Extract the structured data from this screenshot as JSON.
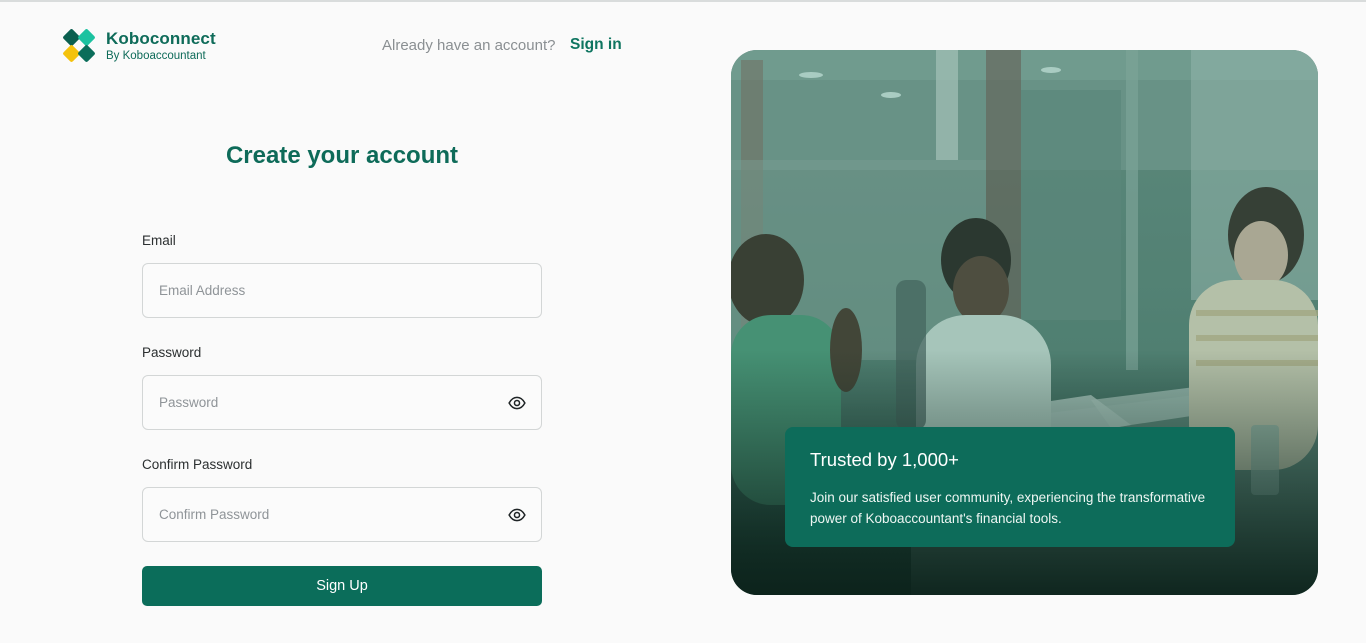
{
  "brand": {
    "name": "Koboconnect",
    "subtitle": "By Koboaccountant",
    "colors": {
      "primary": "#0e6b59",
      "accent_teal": "#1cc2a0",
      "accent_yellow": "#f4c20d"
    }
  },
  "header": {
    "prompt": "Already have an account?",
    "signin_label": "Sign in"
  },
  "form": {
    "title": "Create your account",
    "email": {
      "label": "Email",
      "placeholder": "Email Address",
      "value": ""
    },
    "password": {
      "label": "Password",
      "placeholder": "Password",
      "value": "",
      "toggle_icon": "eye-icon"
    },
    "confirm_password": {
      "label": "Confirm Password",
      "placeholder": "Confirm Password",
      "value": "",
      "toggle_icon": "eye-icon"
    },
    "submit_label": "Sign Up"
  },
  "hero": {
    "card_title": "Trusted by 1,000+",
    "card_body": "Join our satisfied user community, experiencing the transformative power of Koboaccountant's financial tools."
  }
}
